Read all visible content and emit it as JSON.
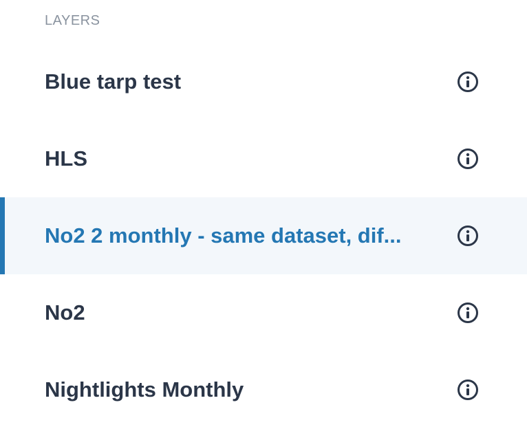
{
  "panel": {
    "heading": "LAYERS"
  },
  "layers": [
    {
      "name": "Blue tarp test",
      "active": false,
      "icon": "info-icon"
    },
    {
      "name": "HLS",
      "active": false,
      "icon": "info-icon"
    },
    {
      "name": "No2 2 monthly - same dataset, dif...",
      "active": true,
      "icon": "info-icon"
    },
    {
      "name": "No2",
      "active": false,
      "icon": "info-icon"
    },
    {
      "name": "Nightlights Monthly",
      "active": false,
      "icon": "info-icon"
    }
  ],
  "colors": {
    "accent": "#2477b3",
    "text": "#2b3648",
    "muted": "#8a939f",
    "active_background": "#f3f7fb"
  }
}
